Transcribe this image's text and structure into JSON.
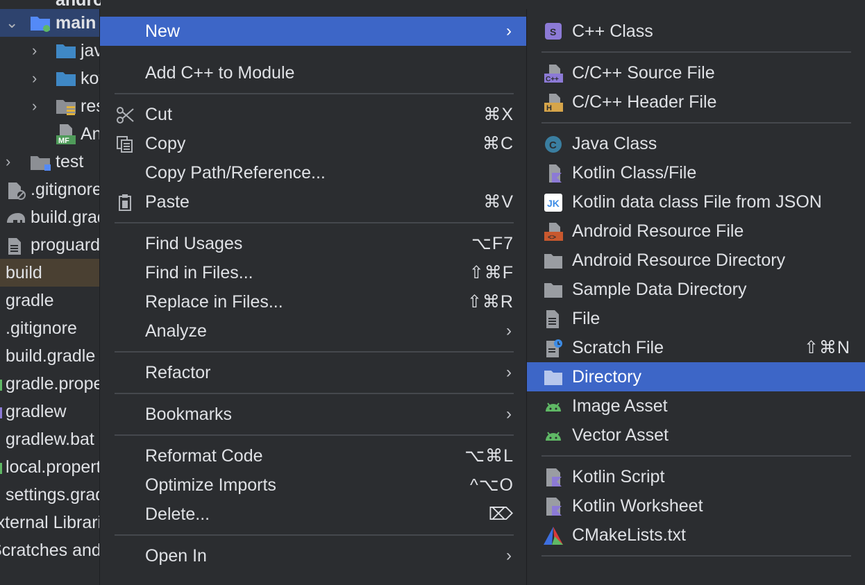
{
  "tree": {
    "items": [
      {
        "label": "android test",
        "indent": 1
      },
      {
        "label": "main",
        "indent": 1
      },
      {
        "label": "java",
        "indent": 2
      },
      {
        "label": "kotlin",
        "indent": 2
      },
      {
        "label": "res",
        "indent": 2
      },
      {
        "label": "AndroidManifest.xml",
        "indent": 2
      },
      {
        "label": "test",
        "indent": 1
      },
      {
        "label": ".gitignore",
        "indent": 0
      },
      {
        "label": "build.gradle",
        "indent": 0
      },
      {
        "label": "proguard-rules.pro",
        "indent": 0
      },
      {
        "label": "build",
        "indent": 0
      },
      {
        "label": "gradle",
        "indent": 0
      },
      {
        "label": ".gitignore",
        "indent": 0
      },
      {
        "label": "build.gradle",
        "indent": 0
      },
      {
        "label": "gradle.properties",
        "indent": 0
      },
      {
        "label": "gradlew",
        "indent": 0
      },
      {
        "label": "gradlew.bat",
        "indent": 0
      },
      {
        "label": "local.properties",
        "indent": 0
      },
      {
        "label": "settings.gradle",
        "indent": 0
      },
      {
        "label": "External Libraries",
        "indent": 0
      },
      {
        "label": "Scratches and Consoles",
        "indent": 0
      }
    ]
  },
  "main_menu": {
    "new": "New",
    "add_cpp": "Add C++ to Module",
    "cut": "Cut",
    "cut_sc": "⌘X",
    "copy": "Copy",
    "copy_sc": "⌘C",
    "copy_path": "Copy Path/Reference...",
    "paste": "Paste",
    "paste_sc": "⌘V",
    "find_usages": "Find Usages",
    "find_usages_sc": "⌥F7",
    "find_in_files": "Find in Files...",
    "find_in_files_sc": "⇧⌘F",
    "replace_in_files": "Replace in Files...",
    "replace_in_files_sc": "⇧⌘R",
    "analyze": "Analyze",
    "refactor": "Refactor",
    "bookmarks": "Bookmarks",
    "reformat": "Reformat Code",
    "reformat_sc": "⌥⌘L",
    "optimize": "Optimize Imports",
    "optimize_sc": "^⌥O",
    "delete": "Delete...",
    "delete_sc": "⌦",
    "open_in": "Open In"
  },
  "sub_menu": {
    "cpp_class": "C++ Class",
    "cpp_source": "C/C++ Source File",
    "cpp_header": "C/C++ Header File",
    "java_class": "Java Class",
    "kotlin_class": "Kotlin Class/File",
    "kotlin_json": "Kotlin data class File from JSON",
    "android_res_file": "Android Resource File",
    "android_res_dir": "Android Resource Directory",
    "sample_data_dir": "Sample Data Directory",
    "file": "File",
    "scratch": "Scratch File",
    "scratch_sc": "⇧⌘N",
    "directory": "Directory",
    "image_asset": "Image Asset",
    "vector_asset": "Vector Asset",
    "kotlin_script": "Kotlin Script",
    "kotlin_worksheet": "Kotlin Worksheet",
    "cmake": "CMakeLists.txt"
  },
  "colors": {
    "background": "#2b2d30",
    "selection": "#3d66c7",
    "separator": "#45484d",
    "text": "#dfe1e5"
  }
}
